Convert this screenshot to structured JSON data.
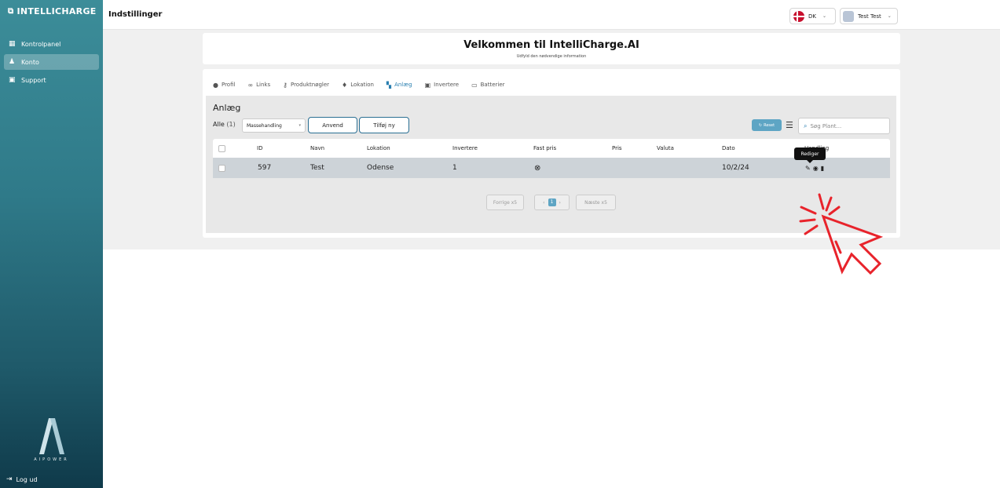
{
  "sidebar": {
    "brand": "INTELLICHARGE",
    "items": [
      {
        "label": "Kontrolpanel",
        "icon": "dashboard-icon"
      },
      {
        "label": "Konto",
        "icon": "account-icon"
      },
      {
        "label": "Support",
        "icon": "support-icon"
      }
    ],
    "logo_text": "AIPOWER",
    "logout": "Log ud"
  },
  "topbar": {
    "title": "Indstillinger",
    "language": "DK",
    "user": "Test Test"
  },
  "welcome": {
    "title": "Velkommen til IntelliCharge.AI",
    "subtitle": "Udfyld den nødvendige information"
  },
  "tabs": [
    {
      "label": "Profil",
      "icon": "user-circle-icon"
    },
    {
      "label": "Links",
      "icon": "link-icon"
    },
    {
      "label": "Produktnøgler",
      "icon": "key-icon"
    },
    {
      "label": "Lokation",
      "icon": "location-pin-icon"
    },
    {
      "label": "Anlæg",
      "icon": "grid-icon",
      "active": true
    },
    {
      "label": "Invertere",
      "icon": "inverter-icon"
    },
    {
      "label": "Batterier",
      "icon": "battery-icon"
    }
  ],
  "panel": {
    "title": "Anlæg",
    "all_label": "Alle",
    "all_count": "(1)",
    "bulk_select": "Massehandling",
    "apply_button": "Anvend",
    "add_button": "Tilføj ny",
    "reset_button": "Reset",
    "search_placeholder": "Søg Plant..."
  },
  "table": {
    "headers": {
      "id": "ID",
      "name": "Navn",
      "location": "Lokation",
      "inverters": "Invertere",
      "fixed_price": "Fast pris",
      "price": "Pris",
      "currency": "Valuta",
      "date": "Dato",
      "action": "Handling"
    },
    "rows": [
      {
        "id": "597",
        "name": "Test",
        "location": "Odense",
        "inverters": "1",
        "fixed_price_icon": "x-circle-icon",
        "price": "",
        "currency": "",
        "date": "10/2/24"
      }
    ]
  },
  "tooltip": "Rediger",
  "pagination": {
    "prev": "Forrige x5",
    "current_page": "1",
    "next": "Næste x5"
  },
  "colors": {
    "accent": "#2a7fb0",
    "reset": "#5ea5c4",
    "cursor": "#e8232b"
  }
}
